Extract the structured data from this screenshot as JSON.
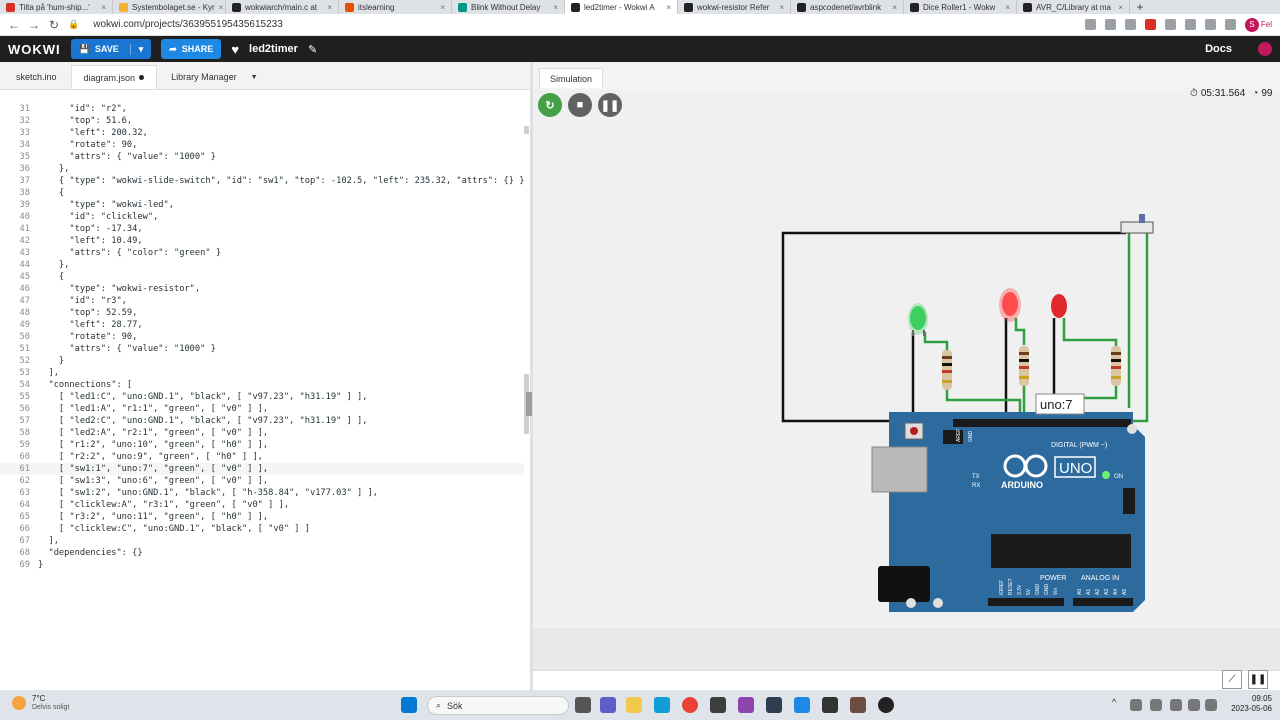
{
  "browser": {
    "tabs": [
      {
        "title": "Tilta på 'hum-ship...'",
        "active": false,
        "favicon_color": "#d93025"
      },
      {
        "title": "Systembolaget.se - Kyr",
        "active": false,
        "favicon_color": "#f2b134"
      },
      {
        "title": "wokwiarch/main.c at",
        "active": false,
        "favicon_color": "#222222"
      },
      {
        "title": "itslearning",
        "active": false,
        "favicon_color": "#e65100"
      },
      {
        "title": "Blink Without Delay",
        "active": false,
        "favicon_color": "#009688"
      },
      {
        "title": "led2timer - Wokwi A",
        "active": true,
        "favicon_color": "#222222"
      },
      {
        "title": "wokwi-resistor Refer",
        "active": false,
        "favicon_color": "#222222"
      },
      {
        "title": "aspcodenet/avrblink",
        "active": false,
        "favicon_color": "#222222"
      },
      {
        "title": "Dice Roller1 - Wokw",
        "active": false,
        "favicon_color": "#222222"
      },
      {
        "title": "AVR_C/Library at ma",
        "active": false,
        "favicon_color": "#222222"
      }
    ],
    "new_tab": "+",
    "url": "wokwi.com/projects/363955195435615233",
    "profile_initial": "S",
    "profile_label": "Fel"
  },
  "header": {
    "logo": "WOKWI",
    "save_label": "SAVE",
    "share_label": "SHARE",
    "project_name": "led2timer",
    "docs_label": "Docs"
  },
  "editor": {
    "tabs": [
      {
        "label": "sketch.ino",
        "active": false
      },
      {
        "label": "diagram.json",
        "active": true,
        "modified": true
      },
      {
        "label": "Library Manager",
        "active": false,
        "dropdown": true
      }
    ],
    "highlight_line": 61,
    "lines": [
      {
        "n": "31",
        "t": "      \"id\": \"r2\","
      },
      {
        "n": "32",
        "t": "      \"top\": 51.6,"
      },
      {
        "n": "33",
        "t": "      \"left\": 200.32,"
      },
      {
        "n": "34",
        "t": "      \"rotate\": 90,"
      },
      {
        "n": "35",
        "t": "      \"attrs\": { \"value\": \"1000\" }"
      },
      {
        "n": "36",
        "t": "    },"
      },
      {
        "n": "37",
        "t": "    { \"type\": \"wokwi-slide-switch\", \"id\": \"sw1\", \"top\": -102.5, \"left\": 235.32, \"attrs\": {} },"
      },
      {
        "n": "38",
        "t": "    {"
      },
      {
        "n": "39",
        "t": "      \"type\": \"wokwi-led\","
      },
      {
        "n": "40",
        "t": "      \"id\": \"clicklew\","
      },
      {
        "n": "41",
        "t": "      \"top\": -17.34,"
      },
      {
        "n": "42",
        "t": "      \"left\": 10.49,"
      },
      {
        "n": "43",
        "t": "      \"attrs\": { \"color\": \"green\" }"
      },
      {
        "n": "44",
        "t": "    },"
      },
      {
        "n": "45",
        "t": "    {"
      },
      {
        "n": "46",
        "t": "      \"type\": \"wokwi-resistor\","
      },
      {
        "n": "47",
        "t": "      \"id\": \"r3\","
      },
      {
        "n": "48",
        "t": "      \"top\": 52.59,"
      },
      {
        "n": "49",
        "t": "      \"left\": 28.77,"
      },
      {
        "n": "50",
        "t": "      \"rotate\": 90,"
      },
      {
        "n": "51",
        "t": "      \"attrs\": { \"value\": \"1000\" }"
      },
      {
        "n": "52",
        "t": "    }"
      },
      {
        "n": "53",
        "t": "  ],"
      },
      {
        "n": "54",
        "t": "  \"connections\": ["
      },
      {
        "n": "55",
        "t": "    [ \"led1:C\", \"uno:GND.1\", \"black\", [ \"v97.23\", \"h31.19\" ] ],"
      },
      {
        "n": "56",
        "t": "    [ \"led1:A\", \"r1:1\", \"green\", [ \"v0\" ] ],"
      },
      {
        "n": "57",
        "t": "    [ \"led2:C\", \"uno:GND.1\", \"black\", [ \"v97.23\", \"h31.19\" ] ],"
      },
      {
        "n": "58",
        "t": "    [ \"led2:A\", \"r2:1\", \"green\", [ \"v0\" ] ],"
      },
      {
        "n": "59",
        "t": "    [ \"r1:2\", \"uno:10\", \"green\", [ \"h0\" ] ],"
      },
      {
        "n": "60",
        "t": "    [ \"r2:2\", \"uno:9\", \"green\", [ \"h0\" ] ],"
      },
      {
        "n": "61",
        "t": "    [ \"sw1:1\", \"uno:7\", \"green\", [ \"v0\" ] ],"
      },
      {
        "n": "62",
        "t": "    [ \"sw1:3\", \"uno:6\", \"green\", [ \"v0\" ] ],"
      },
      {
        "n": "63",
        "t": "    [ \"sw1:2\", \"uno:GND.1\", \"black\", [ \"h-358.84\", \"v177.03\" ] ],"
      },
      {
        "n": "64",
        "t": "    [ \"clicklew:A\", \"r3:1\", \"green\", [ \"v0\" ] ],"
      },
      {
        "n": "65",
        "t": "    [ \"r3:2\", \"uno:11\", \"green\", [ \"h0\" ] ],"
      },
      {
        "n": "66",
        "t": "    [ \"clicklew:C\", \"uno:GND.1\", \"black\", [ \"v0\" ] ]"
      },
      {
        "n": "67",
        "t": "  ],"
      },
      {
        "n": "68",
        "t": "  \"dependencies\": {}"
      },
      {
        "n": "69",
        "t": "}"
      }
    ]
  },
  "simulation": {
    "tab_label": "Simulation",
    "timer": "05:31.564",
    "speed": "99",
    "tooltip": "uno:7",
    "board": {
      "logo_text": "ARDUINO",
      "model": "UNO",
      "digital_label": "DIGITAL (PWM ~)",
      "power_label": "POWER",
      "analog_label": "ANALOG IN",
      "on_label": "ON",
      "tx_label": "TX",
      "rx_label": "RX",
      "aref_label": "AREF",
      "gnd_label": "GND",
      "power_pins": [
        "IOREF",
        "RESET",
        "3.3V",
        "5V",
        "GND",
        "GND",
        "Vin"
      ],
      "analog_pins": [
        "A0",
        "A1",
        "A2",
        "A3",
        "A4",
        "A5"
      ],
      "color": "#2d6a9e"
    },
    "leds": [
      {
        "name": "clicklew",
        "color": "green",
        "lit": true
      },
      {
        "name": "led1",
        "color": "red",
        "lit": true
      },
      {
        "name": "led2",
        "color": "red",
        "lit": false
      }
    ]
  },
  "taskbar": {
    "temperature": "7°C",
    "condition": "Delvis soligt",
    "search_label": "Sök",
    "time": "09:05",
    "date": "2023-05-06"
  }
}
